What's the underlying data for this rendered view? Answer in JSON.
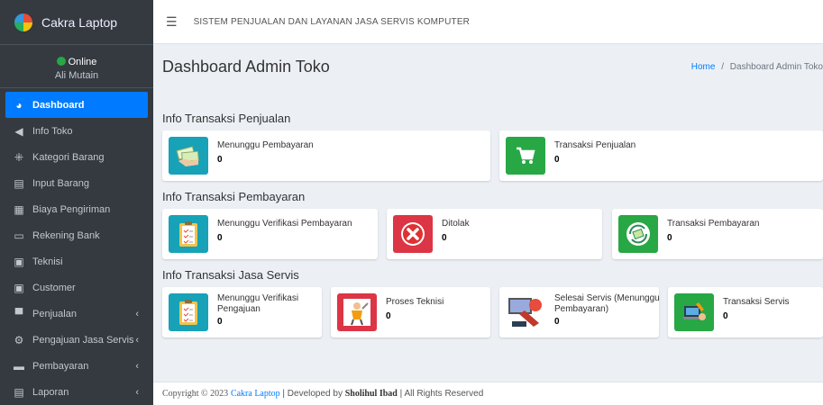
{
  "brand": {
    "name": "Cakra Laptop"
  },
  "user": {
    "status": "Online",
    "name": "Ali Mutain"
  },
  "sidebar": {
    "items": [
      {
        "label": "Dashboard",
        "icon": "dashboard-icon",
        "glyph": "◕"
      },
      {
        "label": "Info Toko",
        "icon": "megaphone-icon",
        "glyph": "📢"
      },
      {
        "label": "Kategori Barang",
        "icon": "tags-icon",
        "glyph": "⁜"
      },
      {
        "label": "Input Barang",
        "icon": "clipboard-icon",
        "glyph": "▤"
      },
      {
        "label": "Biaya Pengiriman",
        "icon": "calculator-icon",
        "glyph": "▦"
      },
      {
        "label": "Rekening Bank",
        "icon": "credit-card-icon",
        "glyph": "▭"
      },
      {
        "label": "Teknisi",
        "icon": "chalkboard-icon",
        "glyph": "▣"
      },
      {
        "label": "Customer",
        "icon": "chalkboard-user-icon",
        "glyph": "▣"
      },
      {
        "label": "Penjualan",
        "icon": "cart-icon",
        "glyph": "🛒"
      },
      {
        "label": "Pengajuan Jasa Servis",
        "icon": "cogs-icon",
        "glyph": "⚙"
      },
      {
        "label": "Pembayaran",
        "icon": "money-icon",
        "glyph": "▬"
      },
      {
        "label": "Laporan",
        "icon": "report-icon",
        "glyph": "▤"
      }
    ],
    "arrow": "‹"
  },
  "topbar": {
    "title": "SISTEM PENJUALAN DAN LAYANAN JASA SERVIS KOMPUTER"
  },
  "header": {
    "page_title": "Dashboard Admin Toko",
    "breadcrumb_home": "Home",
    "breadcrumb_sep": "/",
    "breadcrumb_current": "Dashboard Admin Toko"
  },
  "sections": {
    "penjualan": {
      "title": "Info Transaksi Penjualan",
      "boxes": [
        {
          "label": "Menunggu Pembayaran",
          "value": "0"
        },
        {
          "label": "Transaksi Penjualan",
          "value": "0"
        }
      ]
    },
    "pembayaran": {
      "title": "Info Transaksi Pembayaran",
      "boxes": [
        {
          "label": "Menunggu Verifikasi Pembayaran",
          "value": "0"
        },
        {
          "label": "Ditolak",
          "value": "0"
        },
        {
          "label": "Transaksi Pembayaran",
          "value": "0"
        }
      ]
    },
    "servis": {
      "title": "Info Transaksi Jasa Servis",
      "boxes": [
        {
          "label": "Menunggu Verifikasi Pengajuan",
          "value": "0"
        },
        {
          "label": "Proses Teknisi",
          "value": "0"
        },
        {
          "label": "Selesai Servis (Menunggu Pembayaran)",
          "value": "0"
        },
        {
          "label": "Transaksi Servis",
          "value": "0"
        }
      ]
    }
  },
  "footer": {
    "copyright": "Copyright © 2023",
    "brand": "Cakra Laptop",
    "developed": "| Developed by",
    "developer": "Sholihul Ibad",
    "rights": "| All Rights Reserved"
  },
  "colors": {
    "sidebar": "#343a40",
    "active": "#007bff",
    "info": "#17a2b8",
    "success": "#28a745",
    "danger": "#dc3545"
  }
}
